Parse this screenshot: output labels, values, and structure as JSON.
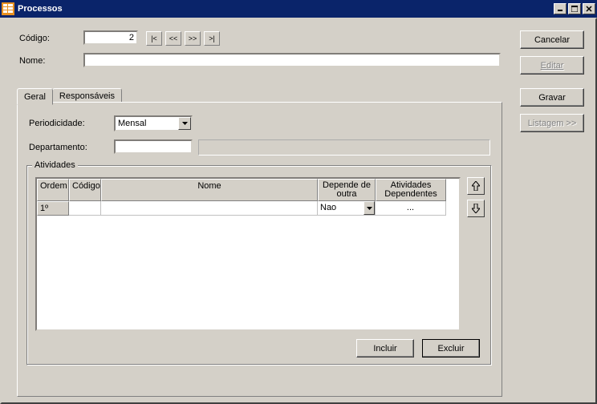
{
  "window": {
    "title": "Processos"
  },
  "form": {
    "codigo_label": "Código:",
    "codigo_value": "2",
    "nome_label": "Nome:",
    "nome_value": ""
  },
  "tabs": {
    "geral": "Geral",
    "responsaveis": "Responsáveis"
  },
  "geral": {
    "periodicidade_label": "Periodicidade:",
    "periodicidade_value": "Mensal",
    "departamento_label": "Departamento:",
    "departamento_value": "",
    "atividades_legend": "Atividades",
    "grid_headers": {
      "ordem": "Ordem",
      "codigo": "Código",
      "nome": "Nome",
      "depende": "Depende de outra",
      "dependentes": "Atividades Dependentes"
    },
    "grid_rows": [
      {
        "ordem": "1º",
        "codigo": "",
        "nome": "",
        "depende": "Nao",
        "dependentes": "..."
      }
    ],
    "incluir_label": "Incluir",
    "excluir_label": "Excluir"
  },
  "buttons": {
    "cancelar": "Cancelar",
    "editar": "Editar",
    "gravar": "Gravar",
    "listagem": "Listagem >>"
  }
}
